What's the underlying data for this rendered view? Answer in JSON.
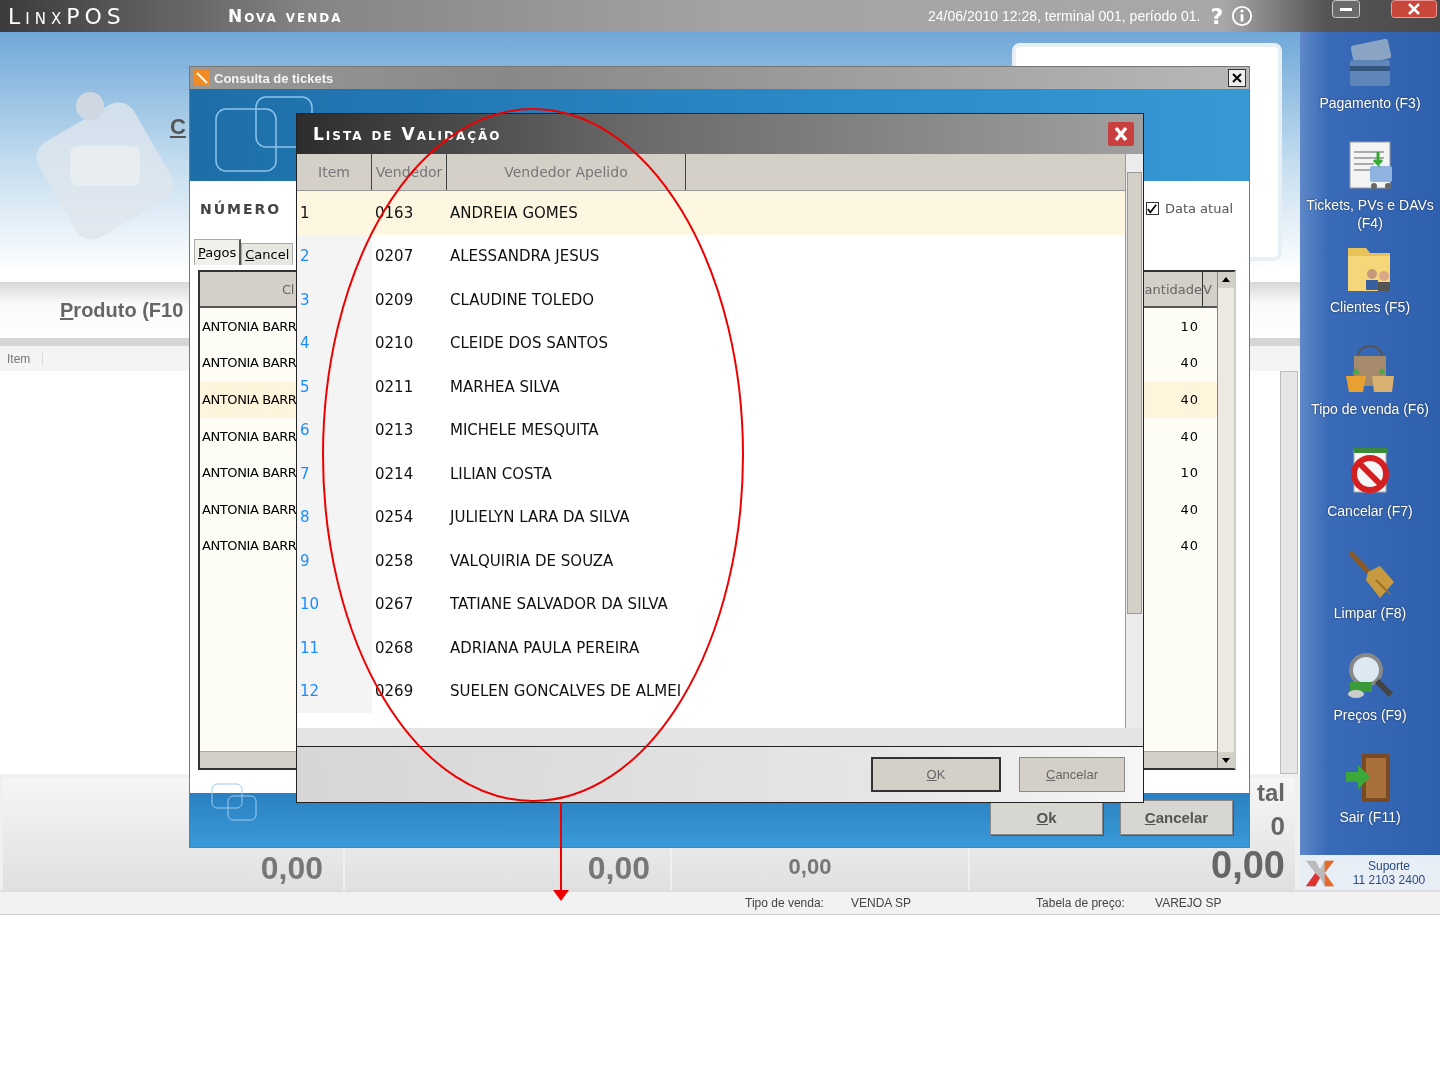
{
  "top_bar": {
    "logo": "LinxPOS",
    "title": "Nova venda",
    "status": "24/06/2010 12:28, terminal 001, período 01.",
    "help": "?"
  },
  "sale": {
    "section_label": "C",
    "product_label": "Produto (F10",
    "item_column": "Item"
  },
  "totals": {
    "values": [
      "0,00",
      "0,00",
      "0,00"
    ],
    "total_label": "tal",
    "count": "0",
    "total": "0,00"
  },
  "status_bar": [
    {
      "label": "Tipo de venda:",
      "value": "VENDA SP"
    },
    {
      "label": "Tabela de preço:",
      "value": "VAREJO SP"
    }
  ],
  "sidebar": {
    "actions": [
      "Pagamento (F3)",
      "Tickets, PVs e DAVs (F4)",
      "Clientes (F5)",
      "Tipo de venda (F6)",
      "Cancelar (F7)",
      "Limpar (F8)",
      "Preços (F9)",
      "Sair (F11)"
    ],
    "support": {
      "label": "Suporte",
      "phone": "11 2103 2400"
    }
  },
  "tickets_window": {
    "title": "Consulta de tickets",
    "number_label": "NÚMERO",
    "current_date": {
      "label": "Data atual",
      "checked": true
    },
    "tabs": [
      {
        "label": "Pagos",
        "selected": true
      },
      {
        "label": "Cancel",
        "selected": false
      }
    ],
    "columns": [
      "Cl",
      "antidade",
      "V"
    ],
    "rows": [
      {
        "column_1": "ANTONIA BARR",
        "quantity": "10",
        "selected": false
      },
      {
        "column_1": "ANTONIA BARR",
        "quantity": "40",
        "selected": false
      },
      {
        "column_1": "ANTONIA BARR",
        "quantity": "40",
        "selected": true
      },
      {
        "column_1": "ANTONIA BARR",
        "quantity": "40",
        "selected": false
      },
      {
        "column_1": "ANTONIA BARR",
        "quantity": "10",
        "selected": false
      },
      {
        "column_1": "ANTONIA BARR",
        "quantity": "40",
        "selected": false
      },
      {
        "column_1": "ANTONIA BARR",
        "quantity": "40",
        "selected": false
      }
    ],
    "buttons": [
      "Ok",
      "Cancelar"
    ]
  },
  "validation_dialog": {
    "title": "Lista de Validação",
    "columns": [
      "Item",
      "Vendedor",
      "Vendedor Apelido"
    ],
    "rows": [
      {
        "item": "1",
        "code": "0163",
        "name": "ANDREIA GOMES",
        "selected": true
      },
      {
        "item": "2",
        "code": "0207",
        "name": "ALESSANDRA JESUS",
        "selected": false
      },
      {
        "item": "3",
        "code": "0209",
        "name": "CLAUDINE TOLEDO",
        "selected": false
      },
      {
        "item": "4",
        "code": "0210",
        "name": "CLEIDE DOS SANTOS",
        "selected": false
      },
      {
        "item": "5",
        "code": "0211",
        "name": "MARHEA SILVA",
        "selected": false
      },
      {
        "item": "6",
        "code": "0213",
        "name": "MICHELE MESQUITA",
        "selected": false
      },
      {
        "item": "7",
        "code": "0214",
        "name": "LILIAN COSTA",
        "selected": false
      },
      {
        "item": "8",
        "code": "0254",
        "name": "JULIELYN LARA DA SILVA",
        "selected": false
      },
      {
        "item": "9",
        "code": "0258",
        "name": "VALQUIRIA DE SOUZA",
        "selected": false
      },
      {
        "item": "10",
        "code": "0267",
        "name": "TATIANE SALVADOR DA SILVA",
        "selected": false
      },
      {
        "item": "11",
        "code": "0268",
        "name": "ADRIANA PAULA PEREIRA",
        "selected": false
      },
      {
        "item": "12",
        "code": "0269",
        "name": "SUELEN GONCALVES DE ALMEI",
        "selected": false
      }
    ],
    "buttons": [
      "OK",
      "Cancelar"
    ]
  }
}
